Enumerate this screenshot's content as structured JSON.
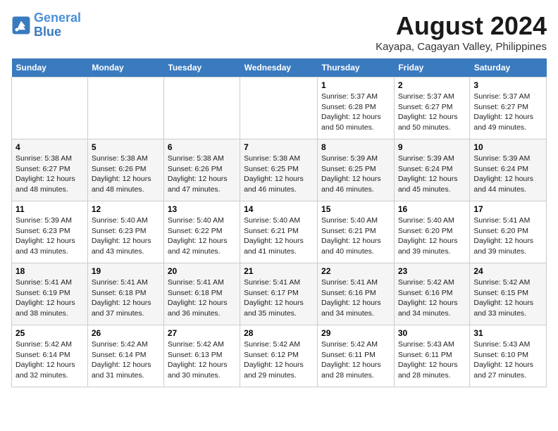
{
  "header": {
    "logo_line1": "General",
    "logo_line2": "Blue",
    "month_year": "August 2024",
    "location": "Kayapa, Cagayan Valley, Philippines"
  },
  "days_of_week": [
    "Sunday",
    "Monday",
    "Tuesday",
    "Wednesday",
    "Thursday",
    "Friday",
    "Saturday"
  ],
  "weeks": [
    [
      {
        "day": "",
        "info": ""
      },
      {
        "day": "",
        "info": ""
      },
      {
        "day": "",
        "info": ""
      },
      {
        "day": "",
        "info": ""
      },
      {
        "day": "1",
        "info": "Sunrise: 5:37 AM\nSunset: 6:28 PM\nDaylight: 12 hours and 50 minutes."
      },
      {
        "day": "2",
        "info": "Sunrise: 5:37 AM\nSunset: 6:27 PM\nDaylight: 12 hours and 50 minutes."
      },
      {
        "day": "3",
        "info": "Sunrise: 5:37 AM\nSunset: 6:27 PM\nDaylight: 12 hours and 49 minutes."
      }
    ],
    [
      {
        "day": "4",
        "info": "Sunrise: 5:38 AM\nSunset: 6:27 PM\nDaylight: 12 hours and 48 minutes."
      },
      {
        "day": "5",
        "info": "Sunrise: 5:38 AM\nSunset: 6:26 PM\nDaylight: 12 hours and 48 minutes."
      },
      {
        "day": "6",
        "info": "Sunrise: 5:38 AM\nSunset: 6:26 PM\nDaylight: 12 hours and 47 minutes."
      },
      {
        "day": "7",
        "info": "Sunrise: 5:38 AM\nSunset: 6:25 PM\nDaylight: 12 hours and 46 minutes."
      },
      {
        "day": "8",
        "info": "Sunrise: 5:39 AM\nSunset: 6:25 PM\nDaylight: 12 hours and 46 minutes."
      },
      {
        "day": "9",
        "info": "Sunrise: 5:39 AM\nSunset: 6:24 PM\nDaylight: 12 hours and 45 minutes."
      },
      {
        "day": "10",
        "info": "Sunrise: 5:39 AM\nSunset: 6:24 PM\nDaylight: 12 hours and 44 minutes."
      }
    ],
    [
      {
        "day": "11",
        "info": "Sunrise: 5:39 AM\nSunset: 6:23 PM\nDaylight: 12 hours and 43 minutes."
      },
      {
        "day": "12",
        "info": "Sunrise: 5:40 AM\nSunset: 6:23 PM\nDaylight: 12 hours and 43 minutes."
      },
      {
        "day": "13",
        "info": "Sunrise: 5:40 AM\nSunset: 6:22 PM\nDaylight: 12 hours and 42 minutes."
      },
      {
        "day": "14",
        "info": "Sunrise: 5:40 AM\nSunset: 6:21 PM\nDaylight: 12 hours and 41 minutes."
      },
      {
        "day": "15",
        "info": "Sunrise: 5:40 AM\nSunset: 6:21 PM\nDaylight: 12 hours and 40 minutes."
      },
      {
        "day": "16",
        "info": "Sunrise: 5:40 AM\nSunset: 6:20 PM\nDaylight: 12 hours and 39 minutes."
      },
      {
        "day": "17",
        "info": "Sunrise: 5:41 AM\nSunset: 6:20 PM\nDaylight: 12 hours and 39 minutes."
      }
    ],
    [
      {
        "day": "18",
        "info": "Sunrise: 5:41 AM\nSunset: 6:19 PM\nDaylight: 12 hours and 38 minutes."
      },
      {
        "day": "19",
        "info": "Sunrise: 5:41 AM\nSunset: 6:18 PM\nDaylight: 12 hours and 37 minutes."
      },
      {
        "day": "20",
        "info": "Sunrise: 5:41 AM\nSunset: 6:18 PM\nDaylight: 12 hours and 36 minutes."
      },
      {
        "day": "21",
        "info": "Sunrise: 5:41 AM\nSunset: 6:17 PM\nDaylight: 12 hours and 35 minutes."
      },
      {
        "day": "22",
        "info": "Sunrise: 5:41 AM\nSunset: 6:16 PM\nDaylight: 12 hours and 34 minutes."
      },
      {
        "day": "23",
        "info": "Sunrise: 5:42 AM\nSunset: 6:16 PM\nDaylight: 12 hours and 34 minutes."
      },
      {
        "day": "24",
        "info": "Sunrise: 5:42 AM\nSunset: 6:15 PM\nDaylight: 12 hours and 33 minutes."
      }
    ],
    [
      {
        "day": "25",
        "info": "Sunrise: 5:42 AM\nSunset: 6:14 PM\nDaylight: 12 hours and 32 minutes."
      },
      {
        "day": "26",
        "info": "Sunrise: 5:42 AM\nSunset: 6:14 PM\nDaylight: 12 hours and 31 minutes."
      },
      {
        "day": "27",
        "info": "Sunrise: 5:42 AM\nSunset: 6:13 PM\nDaylight: 12 hours and 30 minutes."
      },
      {
        "day": "28",
        "info": "Sunrise: 5:42 AM\nSunset: 6:12 PM\nDaylight: 12 hours and 29 minutes."
      },
      {
        "day": "29",
        "info": "Sunrise: 5:42 AM\nSunset: 6:11 PM\nDaylight: 12 hours and 28 minutes."
      },
      {
        "day": "30",
        "info": "Sunrise: 5:43 AM\nSunset: 6:11 PM\nDaylight: 12 hours and 28 minutes."
      },
      {
        "day": "31",
        "info": "Sunrise: 5:43 AM\nSunset: 6:10 PM\nDaylight: 12 hours and 27 minutes."
      }
    ]
  ]
}
